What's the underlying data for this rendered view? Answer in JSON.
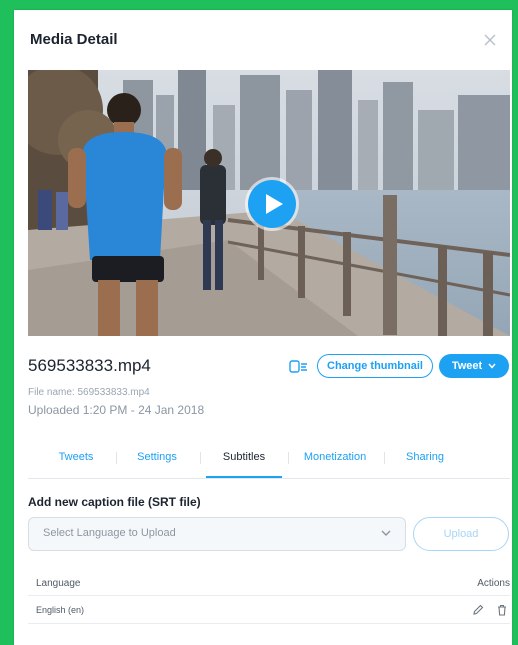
{
  "dialog": {
    "title": "Media Detail"
  },
  "media": {
    "filename": "569533833.mp4",
    "file_name_line": "File name: 569533833.mp4",
    "uploaded": "Uploaded 1:20 PM - 24 Jan 2018"
  },
  "actions": {
    "change_thumbnail": "Change thumbnail",
    "tweet": "Tweet"
  },
  "tabs": [
    {
      "label": "Tweets"
    },
    {
      "label": "Settings"
    },
    {
      "label": "Subtitles"
    },
    {
      "label": "Monetization"
    },
    {
      "label": "Sharing"
    }
  ],
  "captions": {
    "heading": "Add new caption file (SRT file)",
    "select_placeholder": "Select Language to Upload",
    "upload_label": "Upload"
  },
  "table": {
    "col_language": "Language",
    "col_actions": "Actions",
    "rows": [
      {
        "language": "English (en)"
      }
    ]
  },
  "colors": {
    "accent": "#1da1f2",
    "frame": "#1fbf5c"
  },
  "icons": [
    "close-icon",
    "play-icon",
    "caption-icon",
    "chevron-down-icon",
    "edit-icon",
    "trash-icon"
  ]
}
